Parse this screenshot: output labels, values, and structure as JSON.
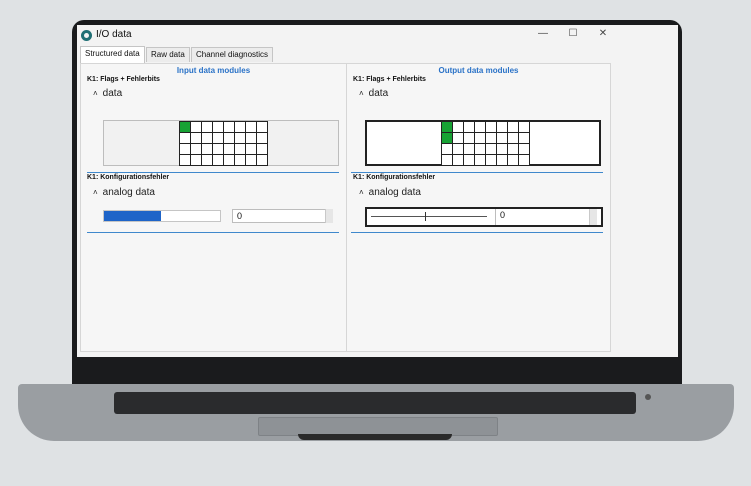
{
  "window": {
    "title": "I/O data",
    "minimize": "—",
    "maximize": "☐",
    "close": "✕"
  },
  "tabs": [
    {
      "label": "Structured data",
      "active": true
    },
    {
      "label": "Raw data",
      "active": false
    },
    {
      "label": "Channel diagnostics",
      "active": false
    }
  ],
  "input_panel": {
    "header": "Input data modules",
    "section1": "K1: Flags + Fehlerbits",
    "group1": "data",
    "group1_caret": "˄",
    "section2": "K1: Konfigurationsfehler",
    "group2": "analog data",
    "group2_caret": "˄",
    "analog_value": "0",
    "analog_fill": 0.49
  },
  "output_panel": {
    "header": "Output data modules",
    "section1": "K1: Flags + Fehlerbits",
    "group1": "data",
    "group1_caret": "˄",
    "section2": "K1: Konfigurationsfehler",
    "group2": "analog data",
    "group2_caret": "˄",
    "slider_value": "0"
  },
  "colors": {
    "accent": "#2a72c7",
    "bit_on": "#17a234",
    "bar_fill": "#1e64c8"
  }
}
